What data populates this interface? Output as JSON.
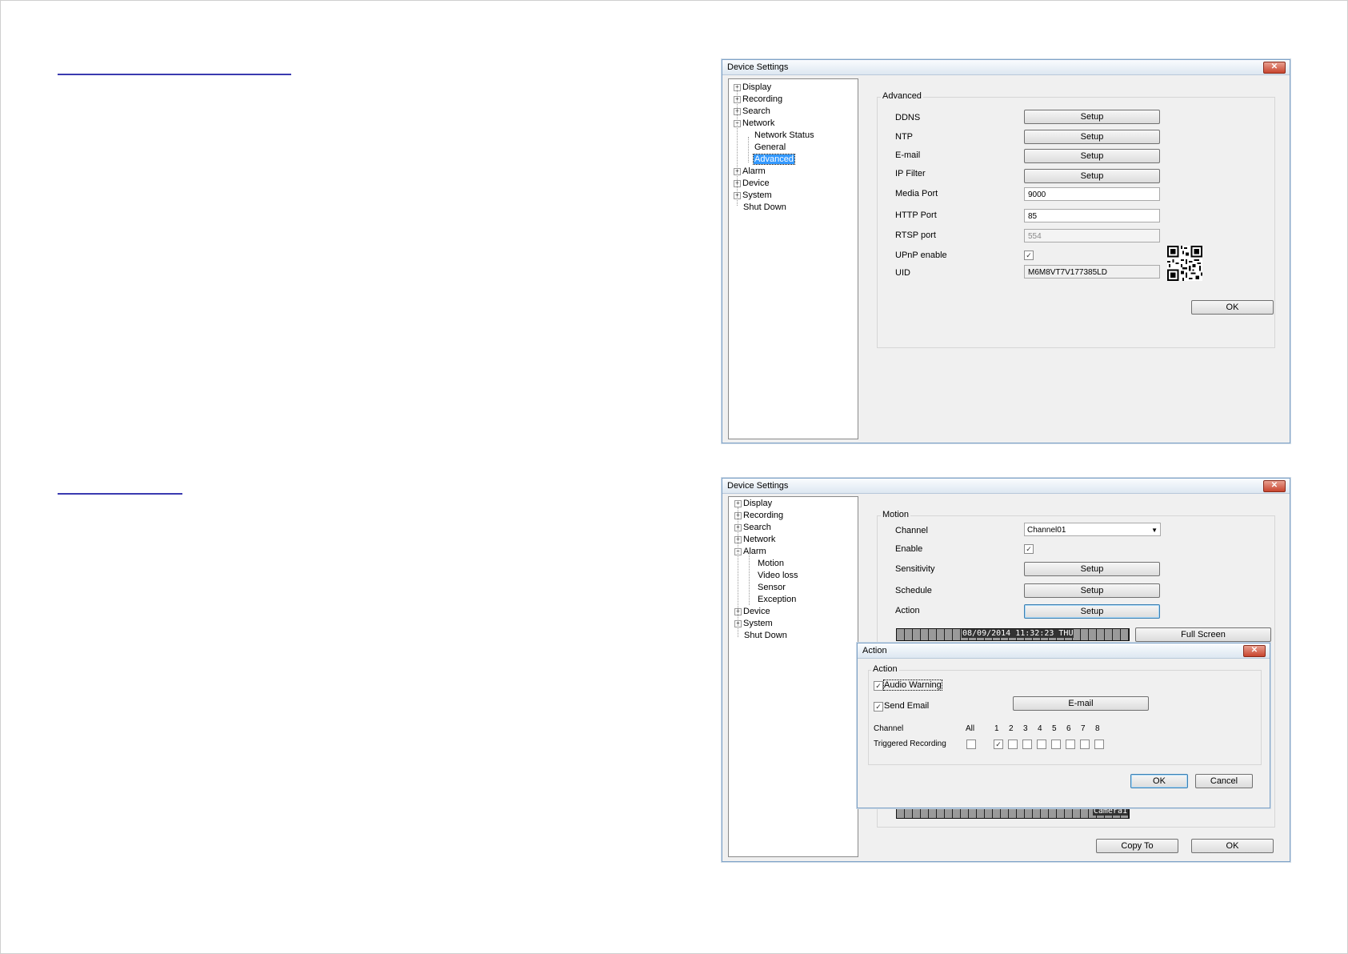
{
  "dialog1": {
    "title": "Device Settings",
    "tree": {
      "items": [
        "Display",
        "Recording",
        "Search",
        "Network"
      ],
      "network_children": [
        "Network Status",
        "General",
        "Advanced"
      ],
      "items_after": [
        "Alarm",
        "Device",
        "System"
      ],
      "shutdown": "Shut Down",
      "selected": "Advanced"
    },
    "group_label": "Advanced",
    "rows": {
      "ddns": "DDNS",
      "ntp": "NTP",
      "email": "E-mail",
      "ipfilter": "IP Filter",
      "media_port": "Media Port",
      "http_port": "HTTP Port",
      "rtsp_port": "RTSP port",
      "upnp": "UPnP enable",
      "uid": "UID"
    },
    "setup_label": "Setup",
    "values": {
      "media_port": "9000",
      "http_port": "85",
      "rtsp_port": "554",
      "uid": "M6M8VT7V177385LD",
      "upnp_checked": true
    },
    "ok_label": "OK"
  },
  "dialog2": {
    "title": "Device Settings",
    "tree": {
      "items": [
        "Display",
        "Recording",
        "Search",
        "Network",
        "Alarm"
      ],
      "alarm_children": [
        "Motion",
        "Video loss",
        "Sensor",
        "Exception"
      ],
      "items_after": [
        "Device",
        "System"
      ],
      "shutdown": "Shut Down"
    },
    "group_label": "Motion",
    "rows": {
      "channel": "Channel",
      "enable": "Enable",
      "sensitivity": "Sensitivity",
      "schedule": "Schedule",
      "action": "Action"
    },
    "channel_value": "Channel01",
    "enable_checked": true,
    "setup_label": "Setup",
    "full_screen": "Full Screen",
    "osd_time": "08/09/2014 11:32:23 THU",
    "osd_camera": "Camera1",
    "copy_to": "Copy To",
    "ok_label": "OK"
  },
  "action_dialog": {
    "title": "Action",
    "group_label": "Action",
    "audio_warning": "Audio Warning",
    "send_email": "Send Email",
    "email_button": "E-mail",
    "channel_label": "Channel",
    "triggered_label": "Triggered Recording",
    "all_label": "All",
    "channels": [
      "1",
      "2",
      "3",
      "4",
      "5",
      "6",
      "7",
      "8"
    ],
    "checked_channels": [
      1
    ],
    "ok": "OK",
    "cancel": "Cancel"
  },
  "colors": {
    "heading_underline": "#3a3ab0",
    "selection": "#3399ff",
    "close_button": "#c8442e"
  }
}
